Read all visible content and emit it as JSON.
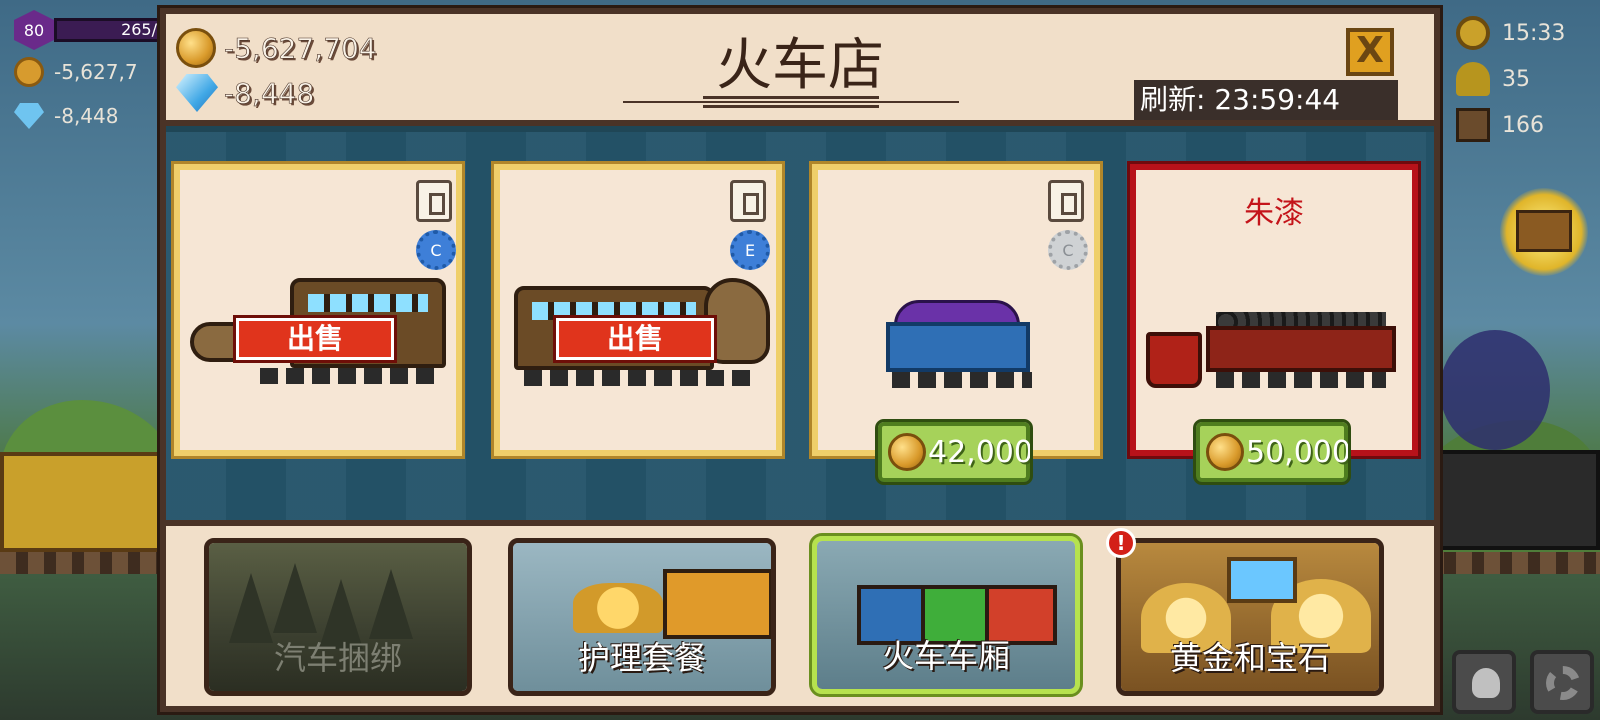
{
  "hud": {
    "level": "80",
    "xp": "265/",
    "coins": "-5,627,7",
    "gems": "-8,448",
    "time": "15:33",
    "population": "35",
    "crates": "166"
  },
  "shop": {
    "title": "火车店",
    "coins": "-5,627,704",
    "gems": "-8,448",
    "refresh_label": "刷新:",
    "refresh_time": "23:59:44",
    "close_label": "X",
    "cards": [
      {
        "type": "car",
        "rank": "C",
        "status": "出售"
      },
      {
        "type": "car",
        "rank": "E",
        "status": "出售"
      },
      {
        "type": "car",
        "rank": "C",
        "price": "42,000"
      },
      {
        "type": "paint",
        "name": "朱漆",
        "price": "50,000"
      }
    ],
    "tabs": [
      {
        "label": "汽车捆绑",
        "state": "disabled"
      },
      {
        "label": "护理套餐",
        "state": "normal"
      },
      {
        "label": "火车车厢",
        "state": "active"
      },
      {
        "label": "黄金和宝石",
        "state": "alert"
      }
    ],
    "alert_badge": "!"
  },
  "colors": {
    "panel": "#f1dfc9",
    "frame": "#4a3327",
    "gold_border": "#efcf6a",
    "red_border": "#b7121a",
    "sell_red": "#e0341c",
    "price_green": "#a6d25a"
  }
}
